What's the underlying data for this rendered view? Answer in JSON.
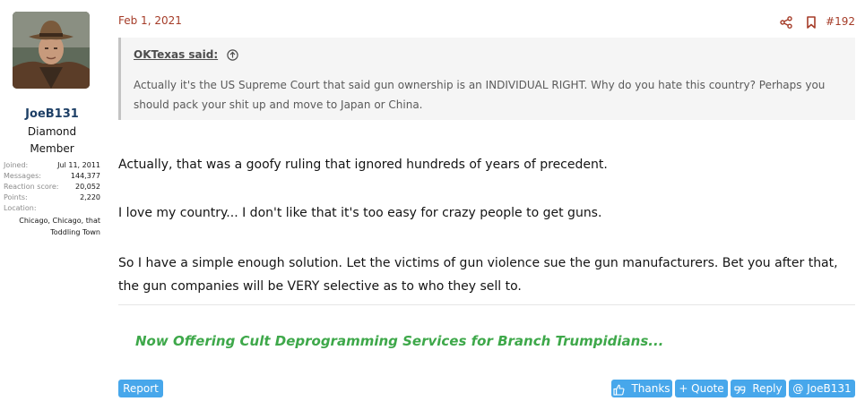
{
  "user": {
    "name": "JoeB131",
    "title": "Diamond Member",
    "extras": [
      {
        "key": "Joined:",
        "value": "Jul 11, 2011"
      },
      {
        "key": "Messages:",
        "value": "144,377"
      },
      {
        "key": "Reaction score:",
        "value": "20,052"
      },
      {
        "key": "Points:",
        "value": "2,220"
      }
    ],
    "location_label": "Location:",
    "location_line1": "Chicago, Chicago, that",
    "location_line2": "Toddling Town"
  },
  "post": {
    "date": "Feb 1, 2021",
    "number": "#192",
    "icons": [
      "share-icon",
      "bookmark-icon"
    ]
  },
  "quote": {
    "author": "OKTexas said:",
    "text": "Actually it's the US Supreme Court that said gun ownership is an INDIVIDUAL RIGHT. Why do you hate this country? Perhaps you should pack your shit up and move to Japan or China."
  },
  "message": {
    "paragraphs": [
      "Actually, that was a goofy ruling that ignored hundreds of years of precedent.",
      "I love my country... I don't like that it's too easy for crazy people to get guns.",
      "So I have a simple enough solution. Let the victims of gun violence sue the gun manufacturers. Bet you after that, the gun companies will be VERY selective as to who they sell to."
    ]
  },
  "signature": "Now Offering Cult Deprogramming Services for Branch Trumpidians...",
  "footer": {
    "report": "Report",
    "thanks": "Thanks",
    "quote": "+ Quote",
    "reply": "Reply",
    "mention": "@ JoeB131"
  },
  "colors": {
    "accent": "#a53c28",
    "button": "#47a7eb",
    "signature": "#3ea84a",
    "username": "#1d3f66"
  }
}
